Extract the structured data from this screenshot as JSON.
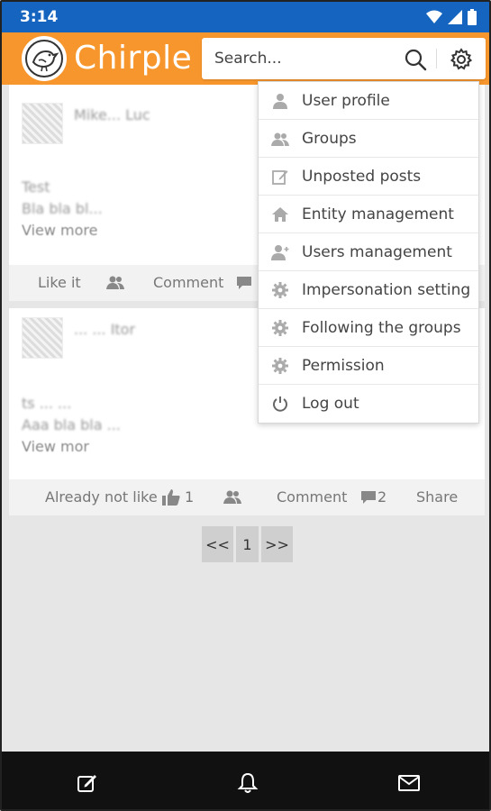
{
  "status_bar": {
    "time": "3:14",
    "icons": [
      "wifi-icon",
      "signal-icon",
      "battery-icon"
    ]
  },
  "header": {
    "app_name": "Chirple",
    "search_placeholder": "Search...",
    "brand_color": "#f7962c",
    "icons": [
      "search-icon",
      "gear-icon"
    ]
  },
  "menu": {
    "items": [
      {
        "label": "User profile",
        "icon": "user-icon"
      },
      {
        "label": "Groups",
        "icon": "group-icon"
      },
      {
        "label": "Unposted posts",
        "icon": "edit-icon"
      },
      {
        "label": "Entity management",
        "icon": "home-icon"
      },
      {
        "label": "Users management",
        "icon": "user-add-icon"
      },
      {
        "label": "Impersonation setting",
        "icon": "gear-icon"
      },
      {
        "label": "Following the groups",
        "icon": "gear-icon"
      },
      {
        "label": "Permission",
        "icon": "gear-icon"
      },
      {
        "label": "Log out",
        "icon": "power-icon"
      }
    ]
  },
  "feed": {
    "posts": [
      {
        "author": "Mike... Luc",
        "line1": "Test",
        "line2": "Bla bla bl...",
        "view_more": "View more",
        "actions": {
          "like": "Like it",
          "comment": "Comment"
        }
      },
      {
        "author": "... ... Itor",
        "line1": "ts ... ...",
        "line2": "Aaa bla bla ...",
        "view_more": "View mor",
        "actions": {
          "like": "Already not like",
          "like_count": "1",
          "comment": "Comment",
          "comment_count": "2",
          "share": "Share"
        }
      }
    ]
  },
  "pagination": {
    "prev": "<<",
    "current": "1",
    "next": ">>"
  },
  "bottom_nav": {
    "icons": [
      "compose-icon",
      "bell-icon",
      "mail-icon"
    ]
  }
}
